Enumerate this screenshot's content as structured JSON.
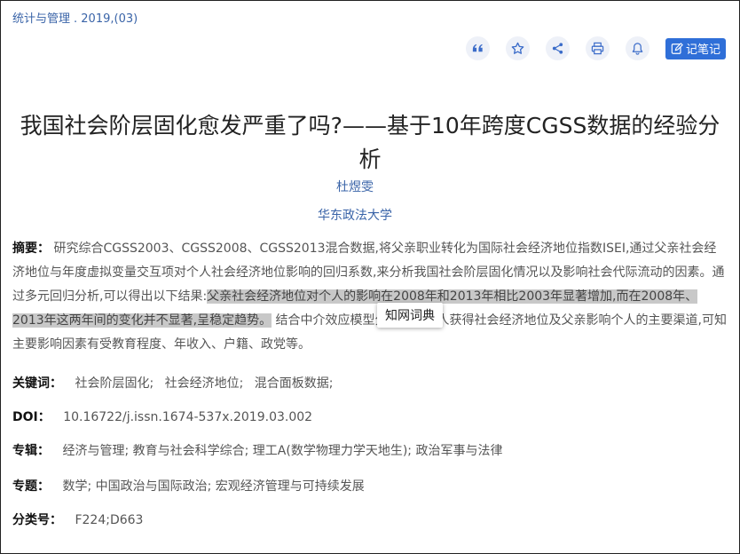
{
  "source": {
    "journal": "统计与管理",
    "issue": ". 2019,(03)"
  },
  "toolbar": {
    "note_label": "记笔记"
  },
  "title": "我国社会阶层固化愈发严重了吗?——基于10年跨度CGSS数据的经验分析",
  "author": "杜煜雯",
  "organization": "华东政法大学",
  "abstract": {
    "label": "摘要：",
    "text_before": " 研究综合CGSS2003、CGSS2008、CGSS2013混合数据,将父亲职业转化为国际社会经济地位指数ISEI,通过父亲社会经济地位与年度虚拟变量交互项对个人社会经济地位影响的回归系数,来分析我国社会阶层固化情况以及影响社会代际流动的因素。通过多元回归分析,可以得出以下结果:",
    "text_highlighted": "父亲社会经济地位对个人的影响在2008年和2013年相比2003年显著增加,而在2008年、2013年这两年间的变化并不显著,呈稳定趋势。",
    "text_after": " 结合中介效应模型分析得出个人获得社会经济地位及父亲影响个人的主要渠道,可知主要影响因素有受教育程度、年收入、户籍、政党等。"
  },
  "tooltip": "知网词典",
  "keywords": {
    "label": "关键词：",
    "items": [
      "社会阶层固化;",
      "社会经济地位;",
      "混合面板数据;"
    ]
  },
  "doi": {
    "label": "DOI：",
    "value": "10.16722/j.issn.1674-537x.2019.03.002"
  },
  "album": {
    "label": "专辑：",
    "value": "经济与管理; 教育与社会科学综合; 理工A(数学物理力学天地生); 政治军事与法律"
  },
  "topic": {
    "label": "专题：",
    "value": "数学; 中国政治与国际政治; 宏观经济管理与可持续发展"
  },
  "classification": {
    "label": "分类号：",
    "value": "F224;D663"
  },
  "colors": {
    "link": "#3a64a8",
    "accent": "#2f6fd8",
    "highlight": "#c8c8c8"
  }
}
